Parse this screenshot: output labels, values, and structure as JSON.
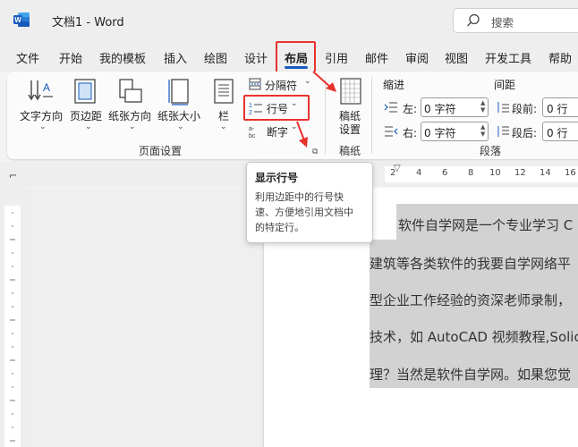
{
  "app": {
    "doc_title": "文档1 - Word",
    "search_placeholder": "搜索"
  },
  "menu": {
    "tabs": [
      "文件",
      "开始",
      "我的模板",
      "插入",
      "绘图",
      "设计",
      "布局",
      "引用",
      "邮件",
      "审阅",
      "视图",
      "开发工具",
      "帮助"
    ],
    "active_tab": "布局"
  },
  "ribbon": {
    "page_setup": {
      "group_label": "页面设置",
      "text_direction": "文字方向",
      "margins": "页边距",
      "orientation": "纸张方向",
      "size": "纸张大小",
      "columns": "栏",
      "breaks": "分隔符",
      "line_numbers": "行号",
      "hyphenation": "断字"
    },
    "manuscript": {
      "group_label": "稿纸",
      "settings_line1": "稿纸",
      "settings_line2": "设置"
    },
    "paragraph": {
      "group_label": "段落",
      "indent_label": "缩进",
      "spacing_label": "间距",
      "left_label": "左:",
      "right_label": "右:",
      "before_label": "段前:",
      "after_label": "段后:",
      "indent_left_value": "0 字符",
      "indent_right_value": "0 字符",
      "spacing_before_value": "0 行",
      "spacing_after_value": "0 行"
    }
  },
  "tooltip": {
    "title": "显示行号",
    "lines": [
      "利用边距中的行号快",
      "速、方便地引用文档中",
      "的特定行。"
    ]
  },
  "ruler": {
    "marks": [
      "2",
      "4",
      "6",
      "8",
      "10",
      "12",
      "14",
      "16"
    ]
  },
  "document": {
    "lines": [
      "软件自学网是一个专业学习 C",
      "建筑等各类软件的我要自学网络平",
      "型企业工作经验的资深老师录制，",
      "技术，如 AutoCAD 视频教程,Solic",
      "理？当然是软件自学网。如果您觉"
    ]
  },
  "colors": {
    "accent": "#185abd",
    "highlight": "#e8322d",
    "word_blue": "#185abd"
  }
}
